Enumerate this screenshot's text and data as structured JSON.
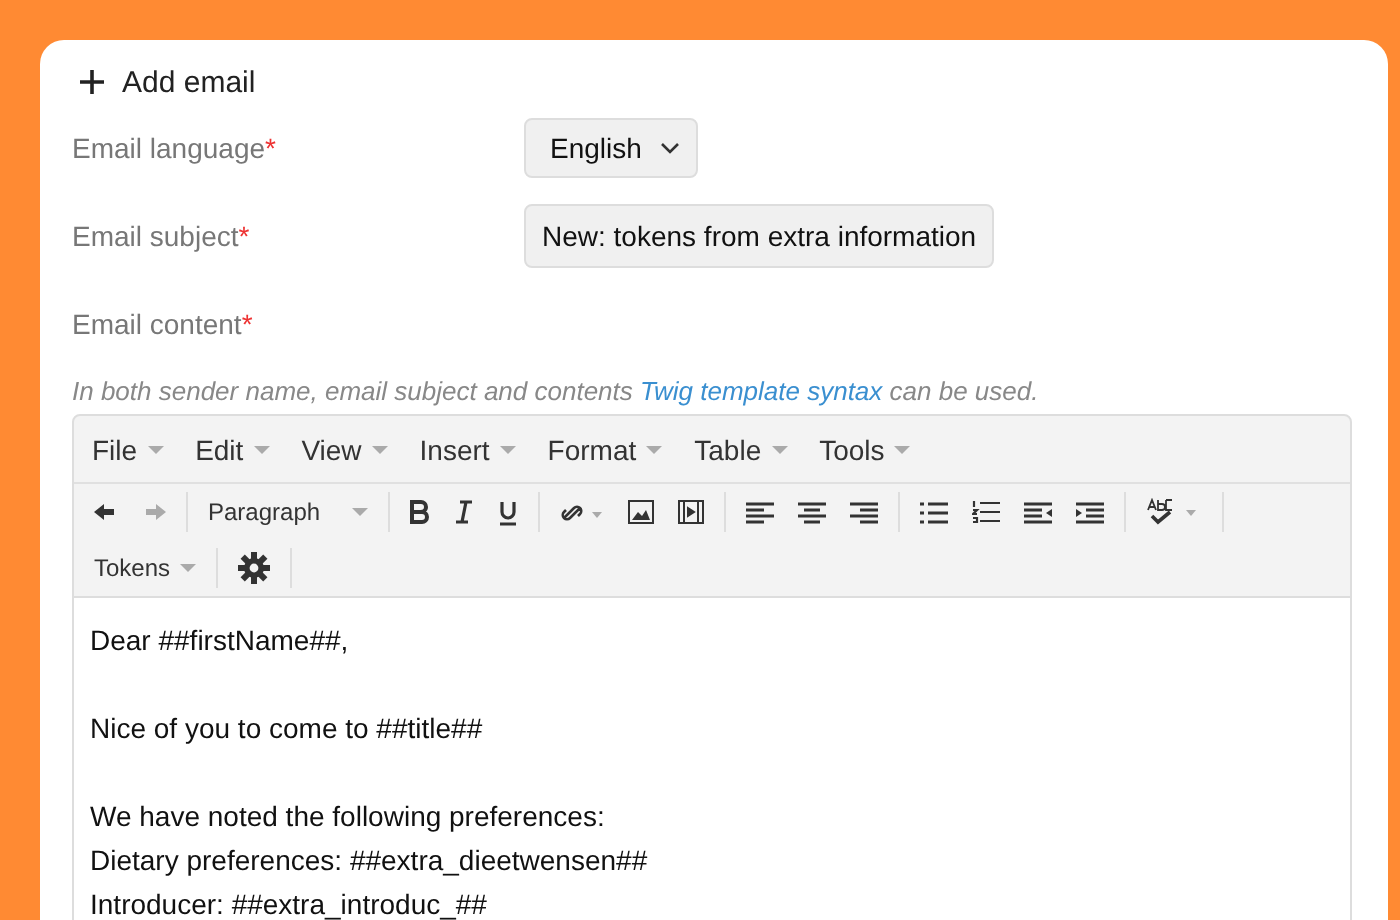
{
  "header": {
    "title": "Add email"
  },
  "fields": [
    {
      "kind": "select",
      "label": "Email language",
      "required_mark": "*",
      "value": "English"
    },
    {
      "kind": "text",
      "label": "Email subject",
      "required_mark": "*",
      "value": "New: tokens from extra information"
    },
    {
      "kind": "label",
      "label": "Email content",
      "required_mark": "*"
    }
  ],
  "hint": {
    "before": "In both sender name, email subject and contents ",
    "link": "Twig template syntax",
    "after": " can be used."
  },
  "editor": {
    "menus": [
      "File",
      "Edit",
      "View",
      "Insert",
      "Format",
      "Table",
      "Tools"
    ],
    "format_select": "Paragraph",
    "tokens_menu": "Tokens",
    "paragraphs": [
      [
        "Dear ##firstName##,"
      ],
      [
        "Nice of you to come to ##title##"
      ],
      [
        "We have noted the following preferences:",
        "Dietary preferences: ##extra_dieetwensen##",
        "Introducer: ##extra_introduc_##"
      ]
    ]
  }
}
